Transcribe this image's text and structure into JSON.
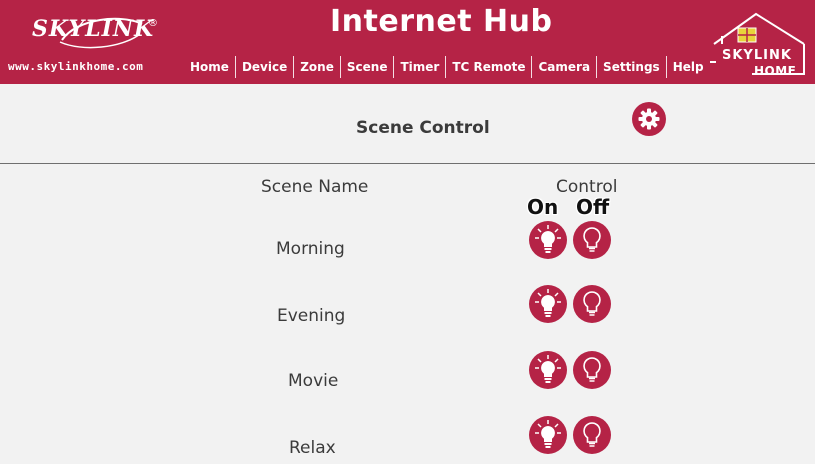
{
  "header": {
    "brand": "SKYLINK",
    "reg_mark": "®",
    "url": "www.skylinkhome.com",
    "title": "Internet Hub",
    "right_logo_top": "SKYLINK",
    "right_logo_bottom": "HOME",
    "accent_color": "#b52346"
  },
  "nav": {
    "items": [
      "Home",
      "Device",
      "Zone",
      "Scene",
      "Timer",
      "TC Remote",
      "Camera",
      "Settings",
      "Help"
    ]
  },
  "page": {
    "title": "Scene Control",
    "settings_icon": "gear-icon"
  },
  "table": {
    "col_name": "Scene Name",
    "col_control": "Control",
    "on_label": "On",
    "off_label": "Off",
    "rows": [
      {
        "name": "Morning"
      },
      {
        "name": "Evening"
      },
      {
        "name": "Movie"
      },
      {
        "name": "Relax"
      }
    ]
  }
}
